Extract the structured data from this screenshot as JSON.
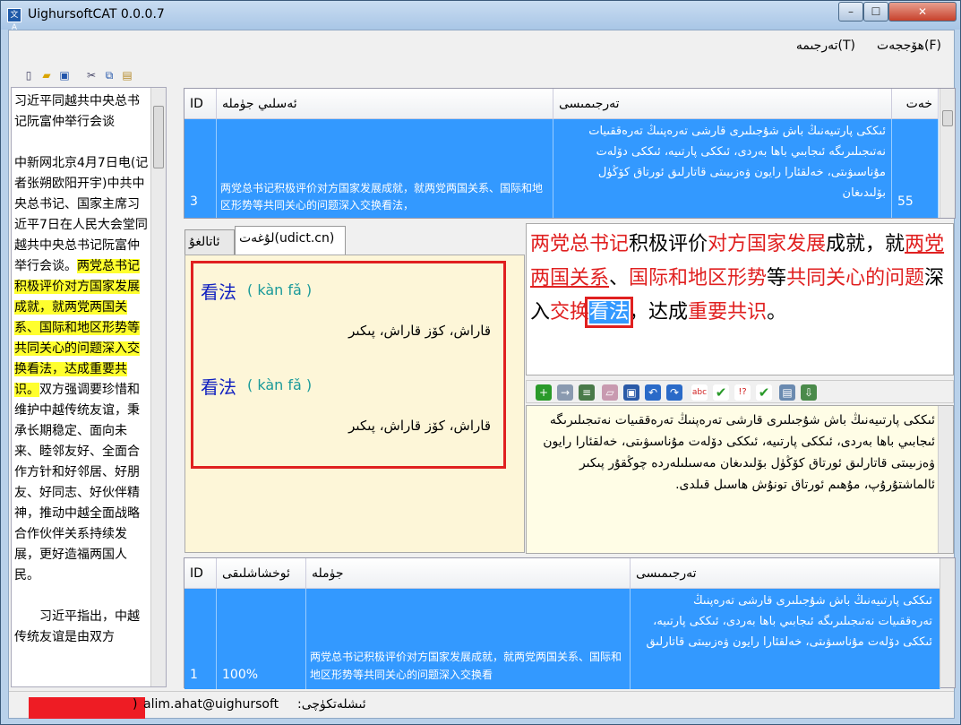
{
  "window": {
    "title": "UighursoftCAT 0.0.0.7",
    "icon_label": "文A",
    "controls": {
      "minimize": "–",
      "maximize": "☐",
      "close": "✕"
    }
  },
  "menubar": {
    "file": "ھۆججەت(F)",
    "translate": "تەرجىمە(T)"
  },
  "left_toolbar": [
    "new-file-icon",
    "open-folder-icon",
    "save-icon",
    "cut-icon",
    "copy-icon",
    "paste-icon"
  ],
  "source_document": {
    "title": "习近平同越共中央总书记阮富仲举行会谈",
    "para1_before": "中新网北京4月7日电(记者张朔欧阳开宇)中共中央总书记、国家主席习近平7日在人民大会堂同越共中央总书记阮富仲举行会谈。",
    "para1_highlight": "两党总书记积极评价对方国家发展成就，就两党两国关系、国际和地区形势等共同关心的问题深入交换看法，达成重要共识。",
    "para1_after": "双方强调要珍惜和维护中越传统友谊，秉承长期稳定、面向未来、睦邻友好、全面合作方针和好邻居、好朋友、好同志、好伙伴精神，推动中越全面战略合作伙伴关系持续发展，更好造福两国人民。",
    "para2": "习近平指出，中越传统友谊是由双方"
  },
  "segments_table": {
    "headers": {
      "id": "ID",
      "source": "ئەسلىي جۈملە",
      "target": "تەرجىمىسى",
      "error": "خەت"
    },
    "rows": [
      {
        "id": "3",
        "source": "两党总书记积极评价对方国家发展成就，就两党两国关系、国际和地区形势等共同关心的问题深入交换看法，",
        "target": "ئىككى پارتىيەنىڭ باش شۇجىلىرى قارشى تەرەپنىڭ تەرەققىيات نەتىجىلىرىگە ئىجابىي باھا بەردى، ئىككى پارتىيە، ئىككى دۆلەت مۇناسىۋىتى، خەلقئارا رايون ۋەزىيىتى قاتارلىق ئورتاق كۆڭۈل بۆلىدىغان",
        "count": "55"
      }
    ]
  },
  "dictionary": {
    "tab_common": "ئاتالغۇ",
    "tab_udict": "لۇغەت(udict.cn)",
    "entries": [
      {
        "word": "看法",
        "pinyin": "( kàn fǎ )",
        "meaning": "قاراش، كۆز قاراش، پىكىر"
      },
      {
        "word": "看法",
        "pinyin": "( kàn fǎ )",
        "meaning": "قاراش، كۆز قاراش، پىكىر"
      }
    ]
  },
  "source_editor": {
    "segments": [
      {
        "text": "两党总书记",
        "style": "red"
      },
      {
        "text": "积极评价",
        "style": "plain"
      },
      {
        "text": "对方国家发展",
        "style": "red"
      },
      {
        "text": "成就，就",
        "style": "plain"
      },
      {
        "text": "两党两国关系",
        "style": "red-u"
      },
      {
        "text": "、",
        "style": "plain"
      },
      {
        "text": "国际和地区形势",
        "style": "red"
      },
      {
        "text": "等",
        "style": "plain"
      },
      {
        "text": "共同关心的问题",
        "style": "red"
      },
      {
        "text": "深入",
        "style": "plain"
      },
      {
        "text": "交换",
        "style": "red"
      },
      {
        "text": "看法",
        "style": "sel"
      },
      {
        "text": "，达成",
        "style": "plain"
      },
      {
        "text": "重要共识",
        "style": "red"
      },
      {
        "text": "。",
        "style": "plain"
      }
    ]
  },
  "target_toolbar": [
    "add-icon",
    "insert-icon",
    "copy-source-icon",
    "eraser-icon",
    "save-icon",
    "undo-icon",
    "redo-icon",
    "spell-icon",
    "check-icon",
    "check-all-icon",
    "confirm-icon",
    "apply-icon",
    "export-icon"
  ],
  "target_editor": {
    "text": "ئىككى پارتىيەنىڭ باش شۇجىلىرى قارشى تەرەپنىڭ تەرەققىيات نەتىجىلىرىگە ئىجابىي باھا بەردى، ئىككى پارتىيە، ئىككى دۆلەت مۇناسىۋىتى، خەلقئارا رايون ۋەزىيىتى قاتارلىق ئورتاق كۆڭۈل بۆلىدىغان مەسىلىلەردە چوڭقۇر پىكىر ئالماشتۇرۇپ، مۇھىم ئورتاق تونۇش ھاسىل قىلدى."
  },
  "memory_table": {
    "headers": {
      "id": "ID",
      "match": "ئوخشاشلىقى",
      "sentence": "جۈملە",
      "translation": "تەرجىمىسى"
    },
    "rows": [
      {
        "id": "1",
        "match": "100%",
        "sentence": "两党总书记积极评价对方国家发展成就，就两党两国关系、国际和地区形势等共同关心的问题深入交换看",
        "translation": "ئىككى پارتىيەنىڭ باش شۇجىلىرى قارشى تەرەپنىڭ تەرەققىيات نەتىجىلىرىگە ئىجابىي باھا بەردى، ئىككى پارتىيە، ئىككى دۆلەت مۇناسىۋىتى، خەلقئارا رايون ۋەزىيىتى قاتارلىق"
      }
    ]
  },
  "statusbar": {
    "user": "alim.ahat@uighursoft",
    "label": "ئىشلەتكۈچى:",
    "paren": ")"
  },
  "colors": {
    "selection": "#3399ff",
    "highlight": "#ffff2e",
    "term_red": "#e02020",
    "dict_bg": "#fdf6d8"
  }
}
